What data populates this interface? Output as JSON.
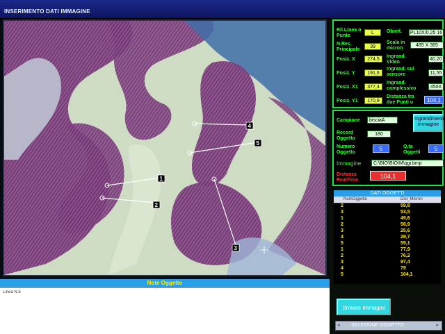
{
  "window": {
    "title": "INSERIMENTO DATI IMMAGINE"
  },
  "markers": [
    "1",
    "2",
    "3",
    "4",
    "5"
  ],
  "measures": {
    "ril_linea_label": "Ril.Linea o Punto",
    "ril_linea_value": "L",
    "nrec_label": "N.Rec. Principale",
    "nrec_value": "39",
    "posx_label": "Posiz. X",
    "posx_value": "274,5",
    "posy_label": "Posiz. Y",
    "posy_value": "191,6",
    "posx1_label": "Posiz. X1",
    "posx1_value": "377,4",
    "posy1_label": "Posiz. Y1",
    "posy1_value": "170,9",
    "obiett_label": "Obiett.",
    "obiett_value": "PL10X/0.25 16",
    "scala_label": "Scala in micron",
    "scala_value": "485 X 365",
    "ingr_video_label": "Ingrand. Video",
    "ingr_video_value": "40,20",
    "ingr_sensore_label": "Ingrand. sul sensore",
    "ingr_sensore_value": "11,55",
    "ingr_compl_label": "Ingrand. complessivo",
    "ingr_compl_value": "450X",
    "distanza_label": "Distanza tra due Punti u",
    "distanza_value": "104,1"
  },
  "sample": {
    "campione_label": "Campione",
    "campione_value": "bisciaA",
    "record_label": "Record Oggetto",
    "record_value": "180",
    "ingrandimenti_button": "Ingrandimenti immagine",
    "numero_label": "Numero Oggetto",
    "numero_value": "5",
    "qta_label": "Q.ta Oggetti",
    "qta_value": "5",
    "immagine_label": "Immagine",
    "immagine_value": "C:\\BIO\\BIOIM\\qgi.bmp",
    "realtime_label": "Distanza RealTime",
    "realtime_value": "104,1"
  },
  "grid": {
    "title": "DATI OGGETTI",
    "col_num": "NumOggetto",
    "col_dist": "Dist_Micron",
    "rows": [
      {
        "n": "2",
        "d": "59,8"
      },
      {
        "n": "3",
        "d": "53,5"
      },
      {
        "n": "1",
        "d": "49,6"
      },
      {
        "n": "2",
        "d": "56,9"
      },
      {
        "n": "3",
        "d": "25,6"
      },
      {
        "n": "4",
        "d": "29,7"
      },
      {
        "n": "5",
        "d": "59,1"
      },
      {
        "n": "1",
        "d": "77,9"
      },
      {
        "n": "2",
        "d": "76,2"
      },
      {
        "n": "3",
        "d": "97,4"
      },
      {
        "n": "4",
        "d": "79"
      },
      {
        "n": "5",
        "d": "104,1"
      }
    ]
  },
  "notes": {
    "header": "Note Oggetto",
    "text": "Linea N.5"
  },
  "browse": {
    "label": "Browse Immagini"
  },
  "selection": {
    "label": "SELEZIONE OGGETTO"
  }
}
